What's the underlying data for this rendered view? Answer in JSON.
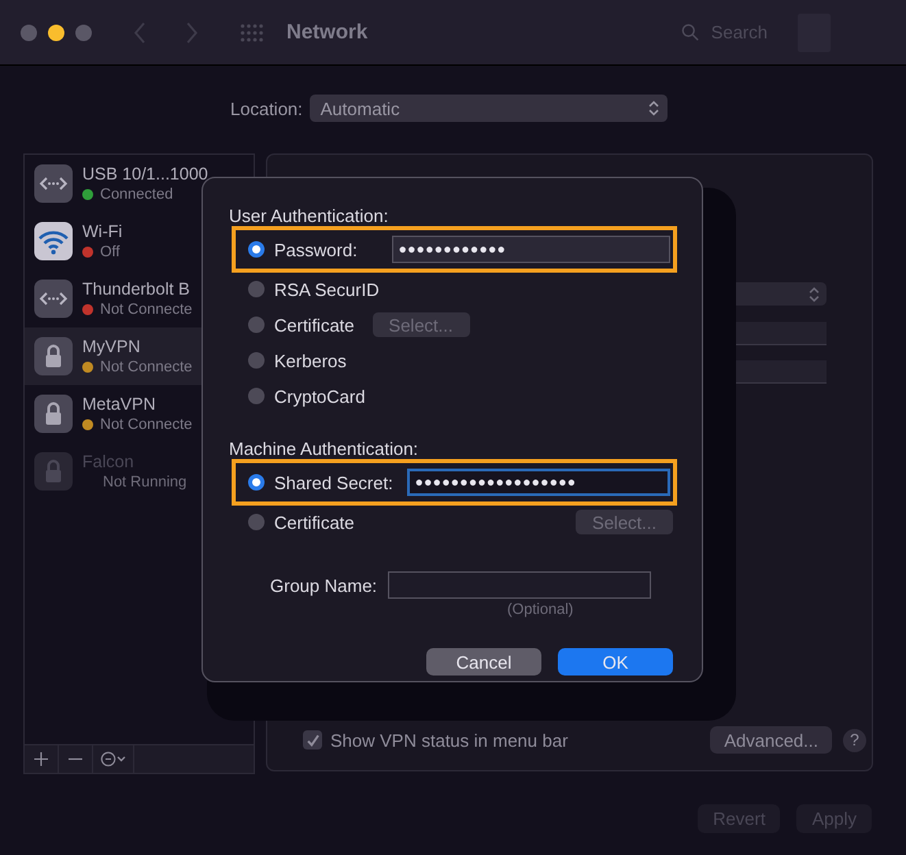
{
  "window": {
    "title": "Network",
    "search_placeholder": "Search"
  },
  "location": {
    "label": "Location:",
    "value": "Automatic"
  },
  "services": [
    {
      "name": "USB 10/1...1000",
      "status": "Connected",
      "color": "#2f9e3a",
      "kind": "ethernet",
      "selected": false,
      "disabled": false
    },
    {
      "name": "Wi-Fi",
      "status": "Off",
      "color": "#c0332c",
      "kind": "wifi",
      "selected": false,
      "disabled": false
    },
    {
      "name": "Thunderbolt B",
      "status": "Not Connecte",
      "color": "#c0332c",
      "kind": "ethernet",
      "selected": false,
      "disabled": false
    },
    {
      "name": "MyVPN",
      "status": "Not Connecte",
      "color": "#c08a22",
      "kind": "lock",
      "selected": true,
      "disabled": false
    },
    {
      "name": "MetaVPN",
      "status": "Not Connecte",
      "color": "#c08a22",
      "kind": "lock",
      "selected": false,
      "disabled": false
    },
    {
      "name": "Falcon",
      "status": "Not Running",
      "kind": "lock",
      "selected": false,
      "disabled": true
    }
  ],
  "show_vpn_status": {
    "label": "Show VPN status in menu bar",
    "checked": true
  },
  "advanced_button": "Advanced...",
  "help_button": "?",
  "footer_buttons": [
    {
      "label": "Revert",
      "disabled": true
    },
    {
      "label": "Apply",
      "disabled": true
    }
  ],
  "sheet": {
    "sections": [
      {
        "heading": "User Authentication:",
        "options": [
          {
            "label": "Password:",
            "selected": true,
            "kind": "field",
            "value": "●●●●●●●●●●●●",
            "highlighted": true,
            "focused": false
          },
          {
            "label": "RSA SecurID",
            "selected": false,
            "kind": "plain"
          },
          {
            "label": "Certificate",
            "selected": false,
            "kind": "select",
            "button": "Select..."
          },
          {
            "label": "Kerberos",
            "selected": false,
            "kind": "plain"
          },
          {
            "label": "CryptoCard",
            "selected": false,
            "kind": "plain"
          }
        ]
      },
      {
        "heading": "Machine Authentication:",
        "options": [
          {
            "label": "Shared Secret:",
            "selected": true,
            "kind": "field",
            "value": "●●●●●●●●●●●●●●●●●●",
            "highlighted": true,
            "focused": true
          },
          {
            "label": "Certificate",
            "selected": false,
            "kind": "selectright",
            "button": "Select..."
          }
        ]
      }
    ],
    "group_name": {
      "label": "Group Name:",
      "note": "(Optional)"
    },
    "buttons": [
      {
        "label": "Cancel",
        "kind": "cancel"
      },
      {
        "label": "OK",
        "kind": "default"
      }
    ]
  }
}
